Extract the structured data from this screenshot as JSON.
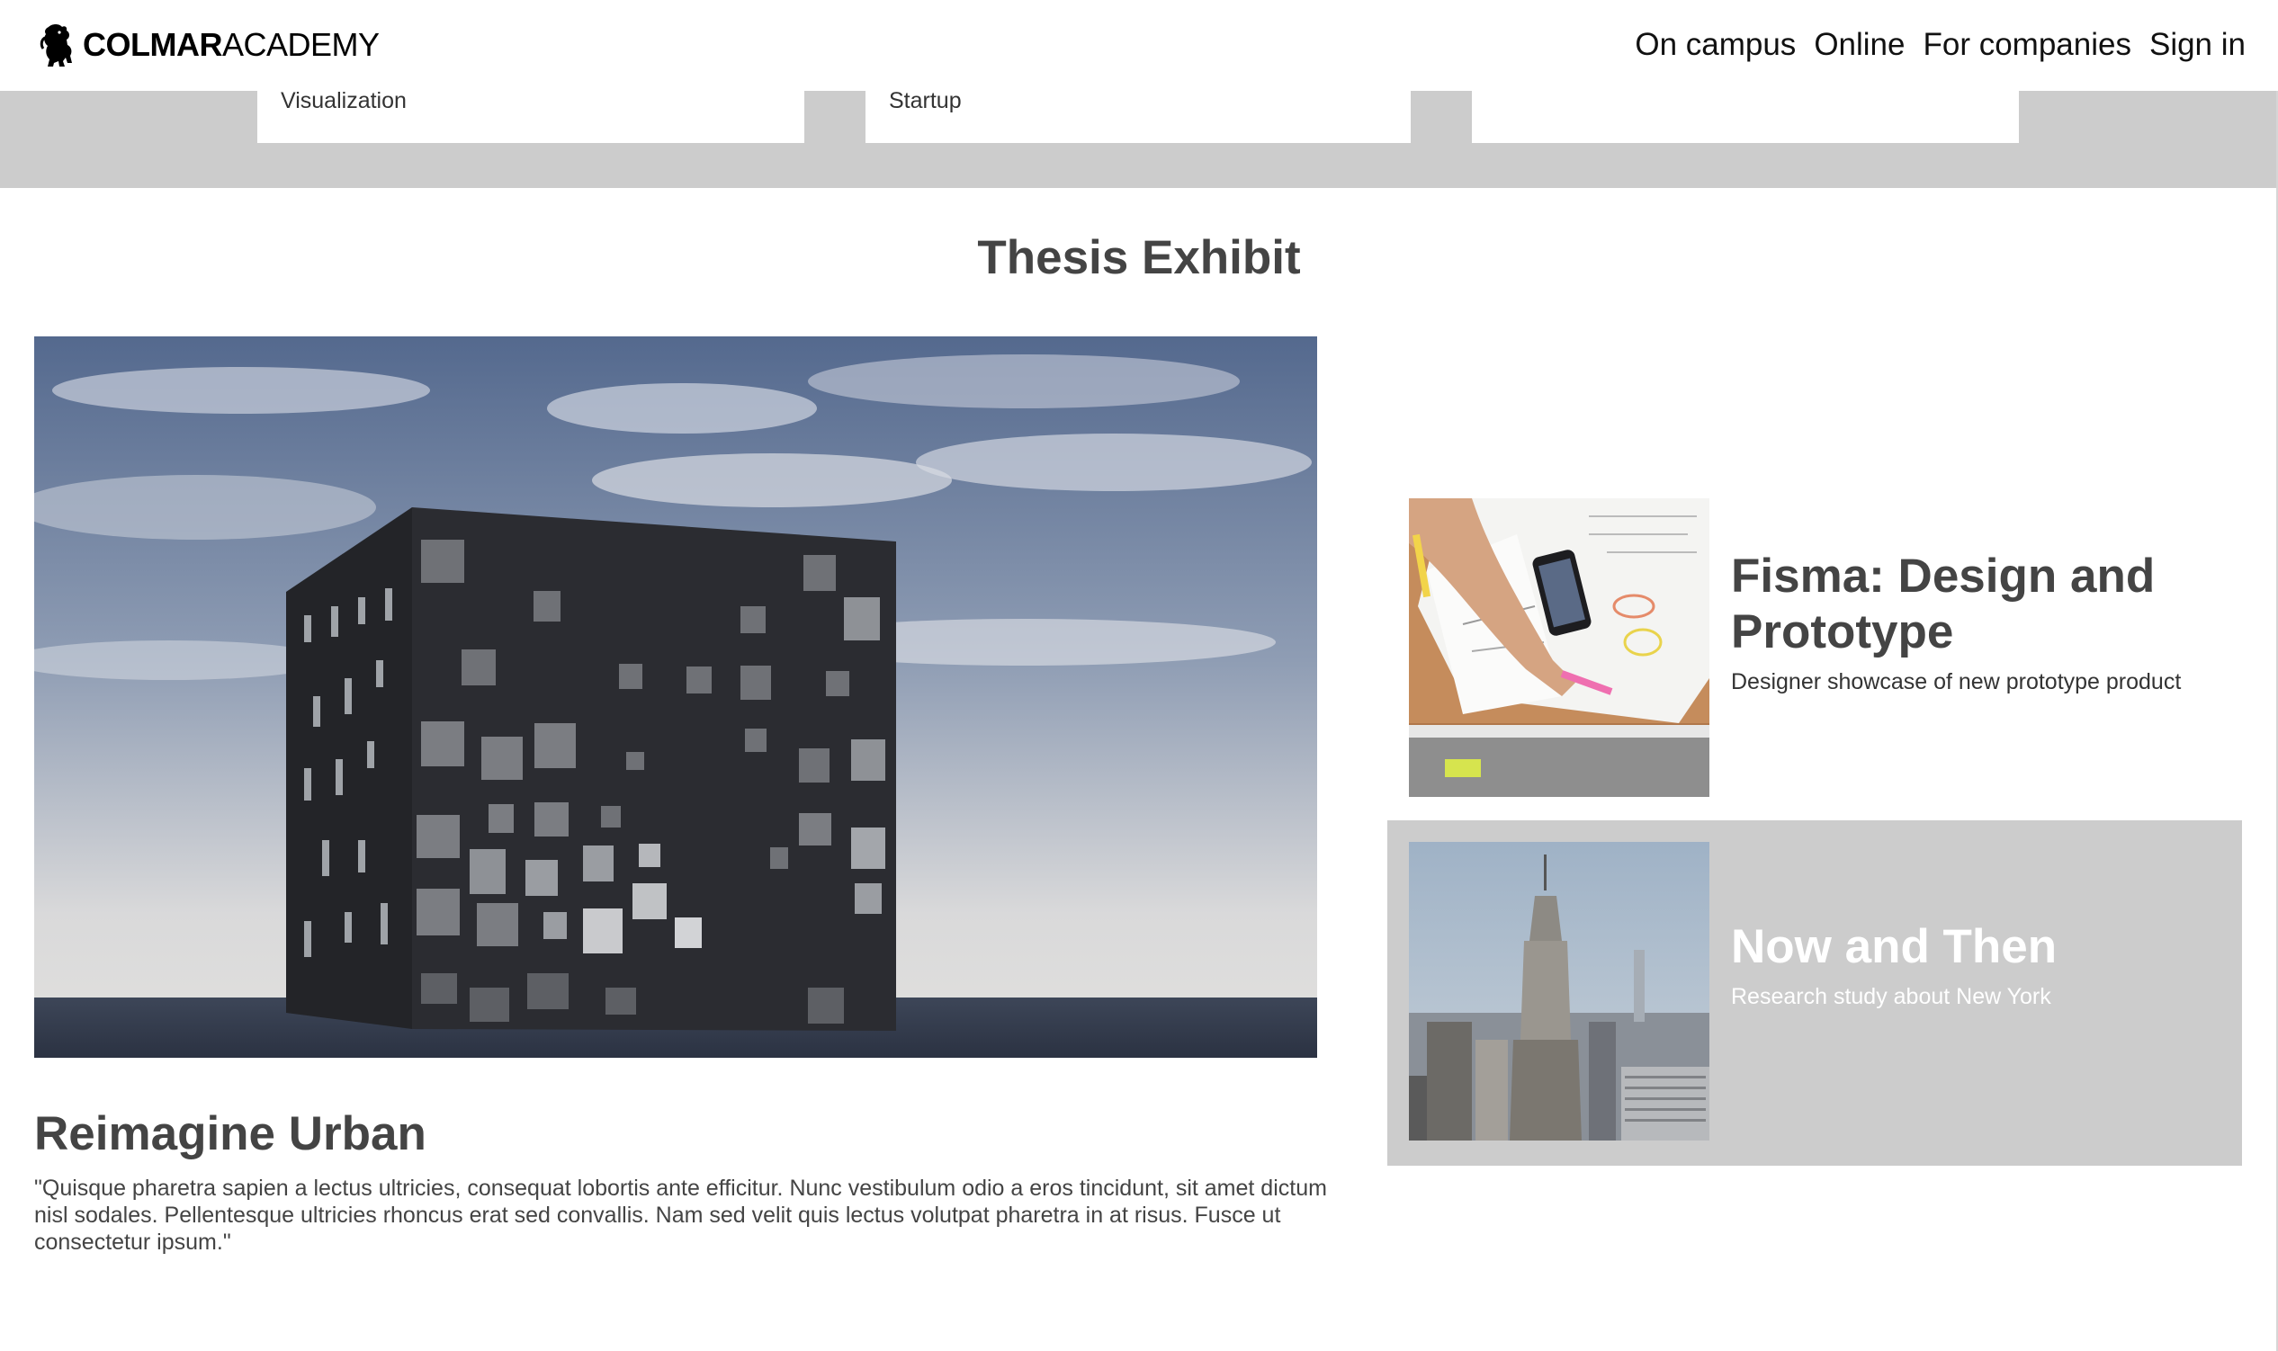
{
  "header": {
    "logo_bold": "COLMAR",
    "logo_light": "ACADEMY",
    "nav": [
      "On campus",
      "Online",
      "For companies",
      "Sign in"
    ]
  },
  "band": {
    "cards": [
      "Visualization",
      "Startup",
      ""
    ]
  },
  "section": {
    "title": "Thesis Exhibit"
  },
  "featured": {
    "title": "Reimagine Urban",
    "description": "\"Quisque pharetra sapien a lectus ultricies, consequat lobortis ante efficitur. Nunc vestibulum odio a eros tincidunt, sit amet dictum nisl sodales. Pellentesque ultricies rhoncus erat sed convallis. Nam sed velit quis lectus volutpat pharetra in at risus. Fusce ut consectetur ipsum.\""
  },
  "cards": [
    {
      "title": "Fisma: Design and Prototype",
      "subtitle": "Designer showcase of new prototype product"
    },
    {
      "title": "Now and Then",
      "subtitle": "Research study about New York"
    }
  ],
  "colors": {
    "band_gray": "#cccccc",
    "text_dark": "#444444",
    "nav_text": "#111111"
  }
}
